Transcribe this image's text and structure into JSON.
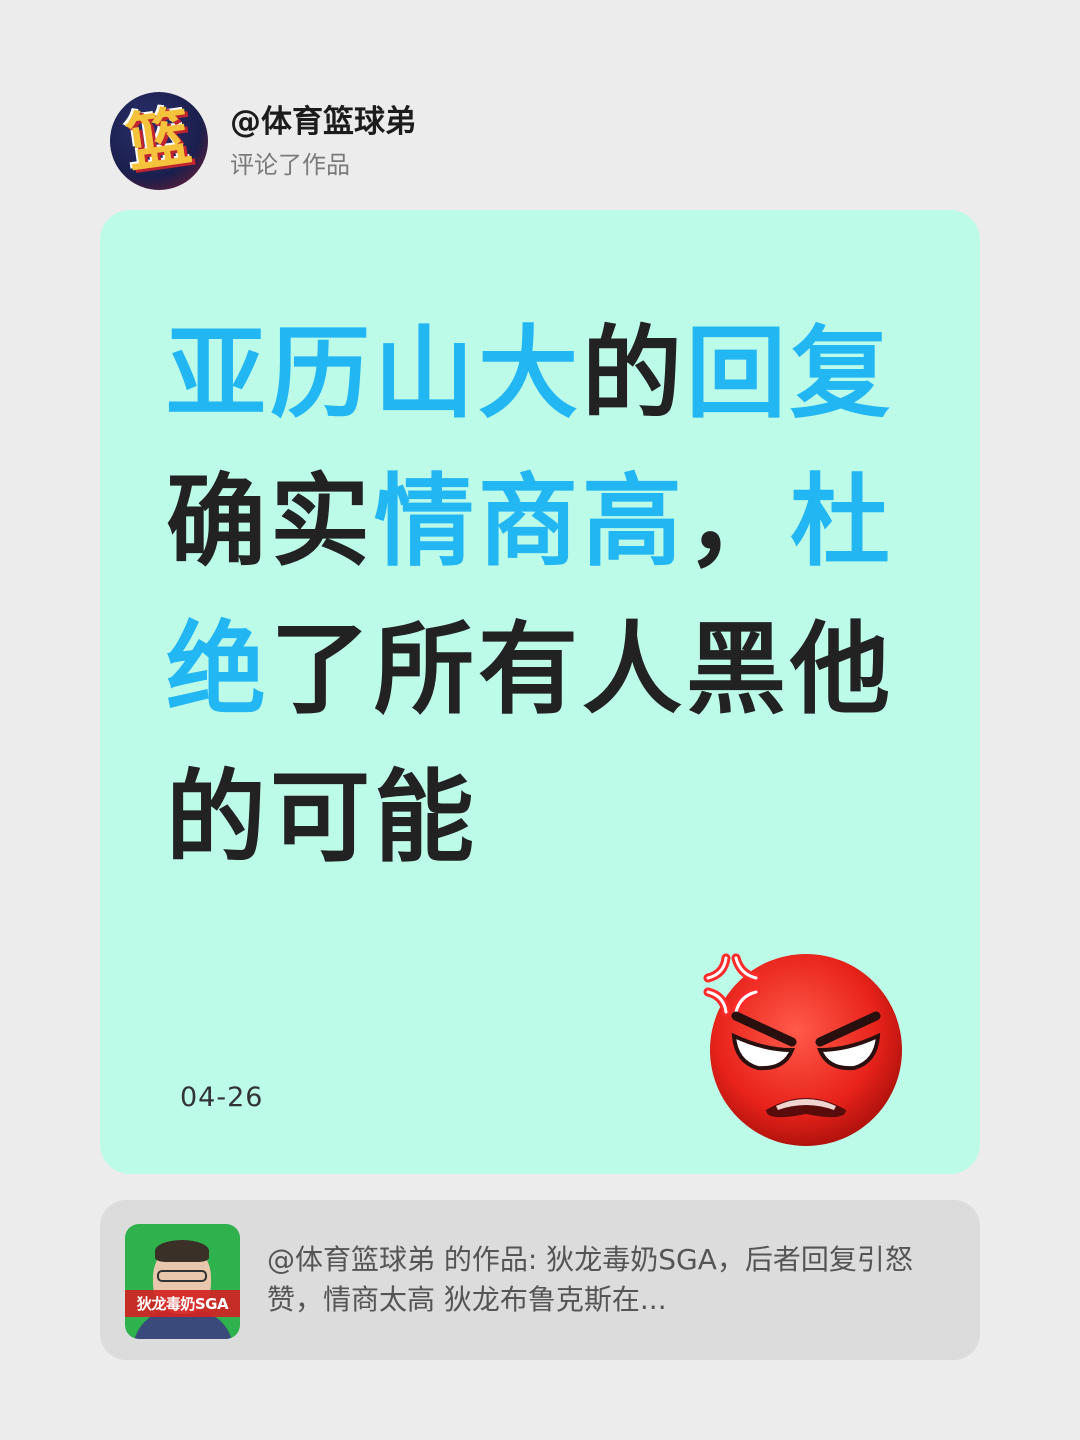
{
  "header": {
    "avatar_glyph": "篮",
    "username": "@体育篮球弟",
    "action": "评论了作品"
  },
  "card": {
    "background": "#bdfbe9",
    "highlight_color": "#22b6f2",
    "text_color": "#222222",
    "headline_segments": [
      {
        "text": "亚历山大",
        "style": "hl"
      },
      {
        "text": "的",
        "style": "dk"
      },
      {
        "text": "回复",
        "style": "hl"
      },
      {
        "text": "确实",
        "style": "dk"
      },
      {
        "text": "情商高",
        "style": "hl"
      },
      {
        "text": "，",
        "style": "dk"
      },
      {
        "text": "杜绝",
        "style": "hl"
      },
      {
        "text": "了所有人黑他的可能",
        "style": "dk"
      }
    ],
    "date": "04-26",
    "emoji": "angry-face-emoji"
  },
  "quote": {
    "thumbnail_label": "狄龙毒奶SGA",
    "text": "@体育篮球弟 的作品: 狄龙毒奶SGA，后者回复引怒赞，情商太高 狄龙布鲁克斯在..."
  }
}
